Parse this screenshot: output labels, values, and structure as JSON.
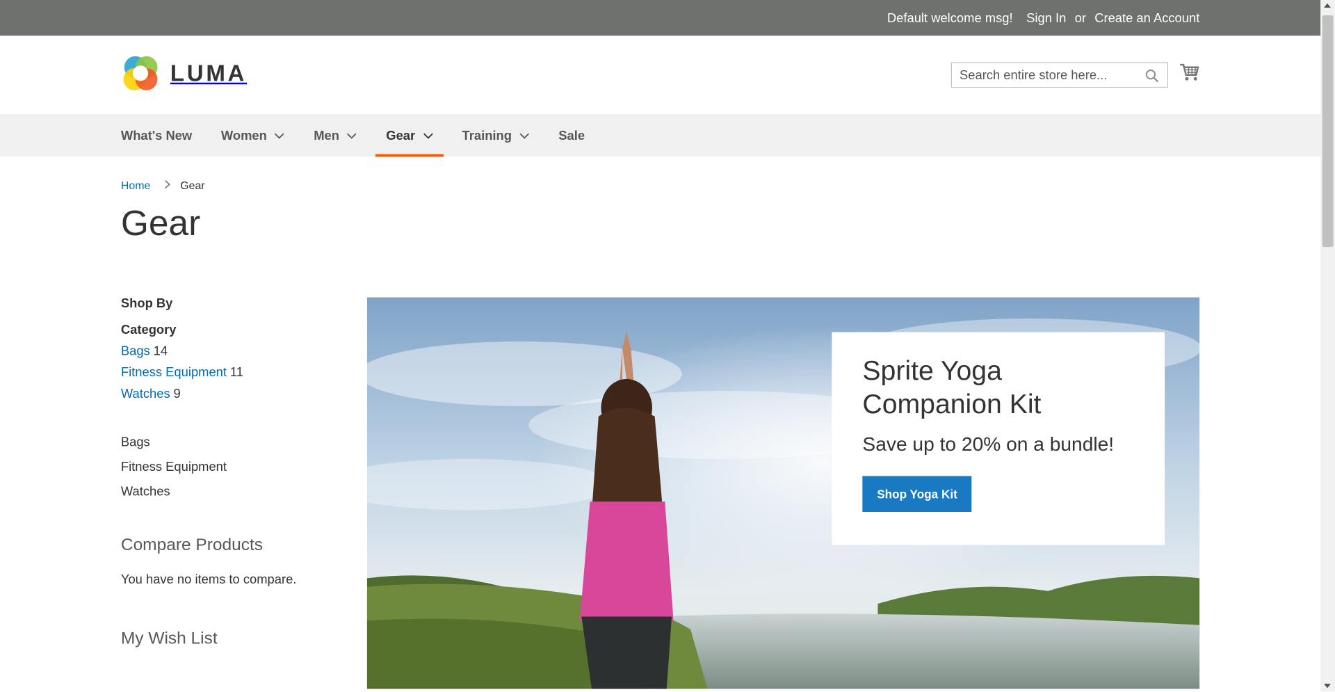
{
  "panel": {
    "welcome": "Default welcome msg!",
    "sign_in": "Sign In",
    "or": "or",
    "create_account": "Create an Account"
  },
  "header": {
    "logo_text": "LUMA",
    "search_placeholder": "Search entire store here...",
    "cart_icon": "cart-icon",
    "search_icon": "magnifier-icon"
  },
  "nav": {
    "items": [
      {
        "label": "What's New"
      },
      {
        "label": "Women"
      },
      {
        "label": "Men"
      },
      {
        "label": "Gear"
      },
      {
        "label": "Training"
      },
      {
        "label": "Sale"
      }
    ],
    "active": "Gear"
  },
  "breadcrumb": {
    "home": "Home",
    "current": "Gear"
  },
  "page_title": "Gear",
  "sidebar": {
    "shop_by": "Shop By",
    "category_title": "Category",
    "filters": [
      {
        "label": "Bags",
        "count": "14"
      },
      {
        "label": "Fitness Equipment",
        "count": "11"
      },
      {
        "label": "Watches",
        "count": "9"
      }
    ],
    "categories": [
      "Bags",
      "Fitness Equipment",
      "Watches"
    ],
    "compare_title": "Compare Products",
    "compare_empty": "You have no items to compare.",
    "wishlist_title": "My Wish List"
  },
  "promo": {
    "title": "Sprite Yoga Companion Kit",
    "subtitle": "Save up to 20% on a bundle!",
    "button": "Shop Yoga Kit"
  },
  "colors": {
    "accent": "#ff5501",
    "link": "#006bb4",
    "button": "#1979c3",
    "panel": "#6e716e"
  }
}
